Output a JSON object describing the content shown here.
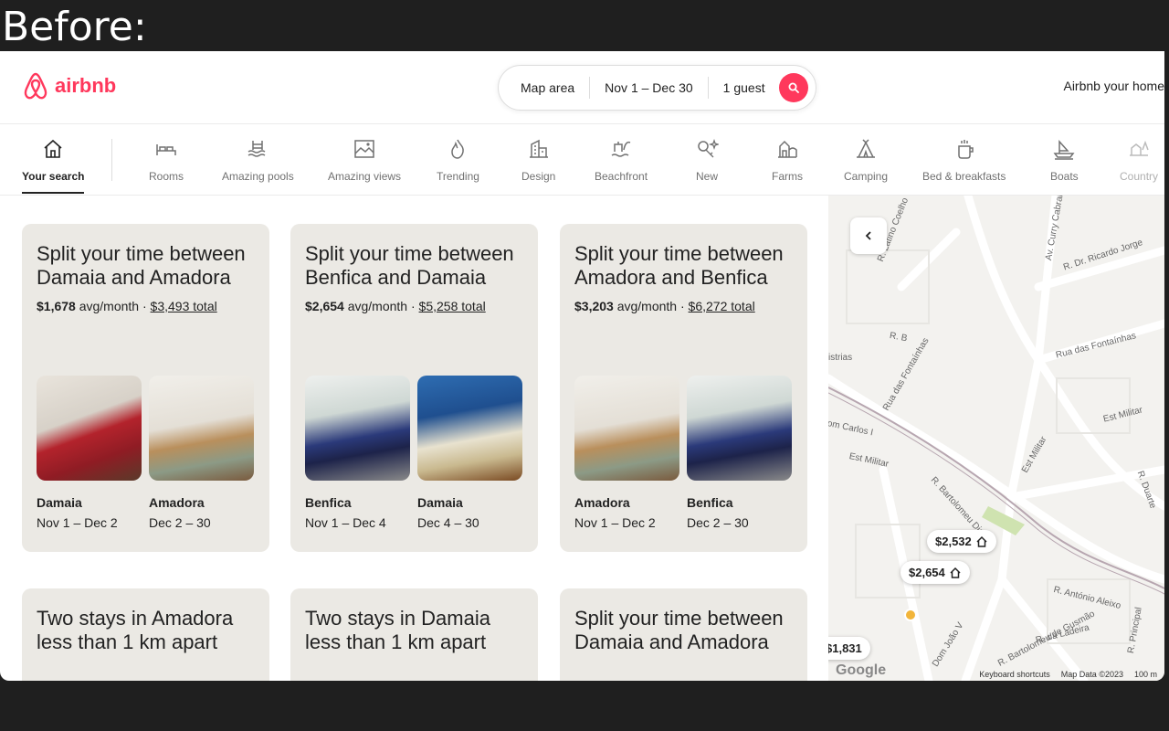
{
  "overlay_label": "Before:",
  "brand": {
    "name": "airbnb",
    "color": "#ff385c"
  },
  "search": {
    "where": "Map area",
    "when": "Nov 1 – Dec 30",
    "who": "1 guest",
    "button_icon": "search-icon"
  },
  "host_link": "Airbnb your home",
  "categories": [
    {
      "label": "Your search",
      "icon": "home-icon",
      "active": true
    },
    {
      "label": "Rooms",
      "icon": "bed-icon"
    },
    {
      "label": "Amazing pools",
      "icon": "pool-icon"
    },
    {
      "label": "Amazing views",
      "icon": "view-icon"
    },
    {
      "label": "Trending",
      "icon": "flame-icon"
    },
    {
      "label": "Design",
      "icon": "building-icon"
    },
    {
      "label": "Beachfront",
      "icon": "beach-icon"
    },
    {
      "label": "New",
      "icon": "key-icon"
    },
    {
      "label": "Farms",
      "icon": "barn-icon"
    },
    {
      "label": "Camping",
      "icon": "tent-icon"
    },
    {
      "label": "Bed & breakfasts",
      "icon": "coffee-icon"
    },
    {
      "label": "Boats",
      "icon": "boat-icon"
    },
    {
      "label": "Country",
      "icon": "country-icon"
    }
  ],
  "cards": [
    {
      "title": "Split your time between Damaia and Amadora",
      "avg": "$1,678",
      "avg_suffix": "avg/month ·",
      "total": "$3,493 total",
      "stays": [
        {
          "place": "Damaia",
          "dates": "Nov 1 – Dec 2"
        },
        {
          "place": "Amadora",
          "dates": "Dec 2 – 30"
        }
      ]
    },
    {
      "title": "Split your time between Benfica and Damaia",
      "avg": "$2,654",
      "avg_suffix": "avg/month ·",
      "total": "$5,258 total",
      "stays": [
        {
          "place": "Benfica",
          "dates": "Nov 1 – Dec 4"
        },
        {
          "place": "Damaia",
          "dates": "Dec 4 – 30"
        }
      ]
    },
    {
      "title": "Split your time between Amadora and Benfica",
      "avg": "$3,203",
      "avg_suffix": "avg/month ·",
      "total": "$6,272 total",
      "stays": [
        {
          "place": "Amadora",
          "dates": "Nov 1 – Dec 2"
        },
        {
          "place": "Benfica",
          "dates": "Dec 2 – 30"
        }
      ]
    },
    {
      "title": "Two stays in Amadora less than 1 km apart"
    },
    {
      "title": "Two stays in Damaia less than 1 km apart"
    },
    {
      "title": "Split your time between Damaia and Amadora"
    }
  ],
  "map": {
    "pins": [
      "$2,532",
      "$2,654",
      "$1,831"
    ],
    "streets": [
      "R. Latino Coelho",
      "Av. Curry Cabral",
      "R. Dr. Ricardo Jorge",
      "Rua das Fontaínhas",
      "R. B",
      "Rua das Fontaínhas",
      "Est Militar",
      "Est Militar",
      "Est Militar",
      "R. Bartolomeu Dias",
      "R. António Aleixo",
      "R. Bartolomeu de Gusmão",
      "R. da Ladeira",
      "Dom João V",
      "R. Principal",
      "R. Duarte",
      "istrias",
      "om Carlos I"
    ],
    "google": "Google",
    "footer": [
      "Keyboard shortcuts",
      "Map Data ©2023",
      "100 m"
    ]
  }
}
